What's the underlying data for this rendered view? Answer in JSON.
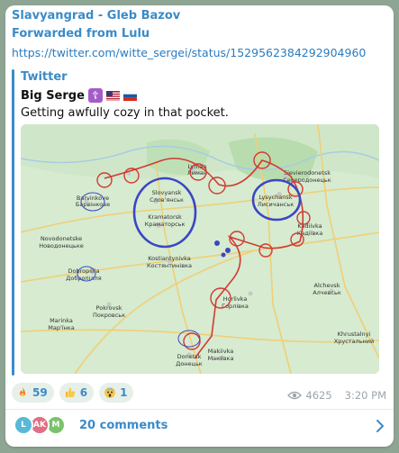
{
  "post": {
    "channel": "Slavyangrad - Gleb Bazov",
    "forwarded": "Forwarded from Lulu",
    "link": "https://twitter.com/witte_sergei/status/1529562384292904960"
  },
  "quote": {
    "site": "Twitter",
    "author": "Big Serge",
    "author_icons": [
      "orthodox-cross-icon",
      "us-flag-icon",
      "ru-flag-icon"
    ],
    "text": "Getting awfully cozy in that pocket."
  },
  "map": {
    "labels": {
      "slovyansk": "Slovyansk",
      "slovyansk_cyr": "Слов'янськ",
      "kramatorsk": "Kramatorsk",
      "kramatorsk_cyr": "Краматорськ",
      "lyman": "Lyman",
      "lyman_cyr": "Лиман",
      "sievierodonetsk": "Sievierodonetsk",
      "sievierodonetsk_cyr": "Северодонецьк",
      "lysychansk": "Lysychansk",
      "lysychansk_cyr": "Лисичанськ",
      "barvinkove": "Barvinkove",
      "barvinkove_cyr": "Барвінкове",
      "kostiantynivka": "Kostiantynivka",
      "kostiantynivka_cyr": "Костянтинівка",
      "horlivka": "Horlivka",
      "horlivka_cyr": "Горлівка",
      "donetsk": "Donetsk",
      "donetsk_cyr": "Донецьк",
      "makiivka": "Makiivka",
      "makiivka_cyr": "Макіївка",
      "alchevsk": "Alchevsk",
      "alchevsk_cyr": "Алчевськ",
      "pokrovsk": "Pokrovsk",
      "pokrovsk_cyr": "Покровськ",
      "dobropillia": "Dobropillia",
      "dobropillia_cyr": "Добропілля",
      "novodonetske": "Novodonetske",
      "novodonetske_cyr": "Новодонецьке",
      "kadiivka": "Kadiivka",
      "kadiivka_cyr": "Кадіївка",
      "khrustalnyi": "Khrustalnyi",
      "khrustalnyi_cyr": "Хрустальний",
      "mariinka": "Marinka",
      "mariinka_cyr": "Мар'їнка"
    },
    "colors": {
      "land": "#d8ecd3",
      "road": "#f3d88a",
      "circle_blue": "#3b46c4",
      "circle_red": "#d13a33"
    }
  },
  "reactions": [
    {
      "icon": "fire-icon",
      "count": "59"
    },
    {
      "icon": "thumbs-up-icon",
      "count": "6"
    },
    {
      "icon": "scream-icon",
      "count": "1"
    }
  ],
  "meta": {
    "views": "4625",
    "time": "3:20 PM"
  },
  "comments": {
    "label": "20 comments",
    "avatars": [
      {
        "letter": "L",
        "color": "#58b9d6"
      },
      {
        "letter": "AK",
        "color": "#e06f85"
      },
      {
        "letter": "M",
        "color": "#7bc26c"
      }
    ]
  }
}
